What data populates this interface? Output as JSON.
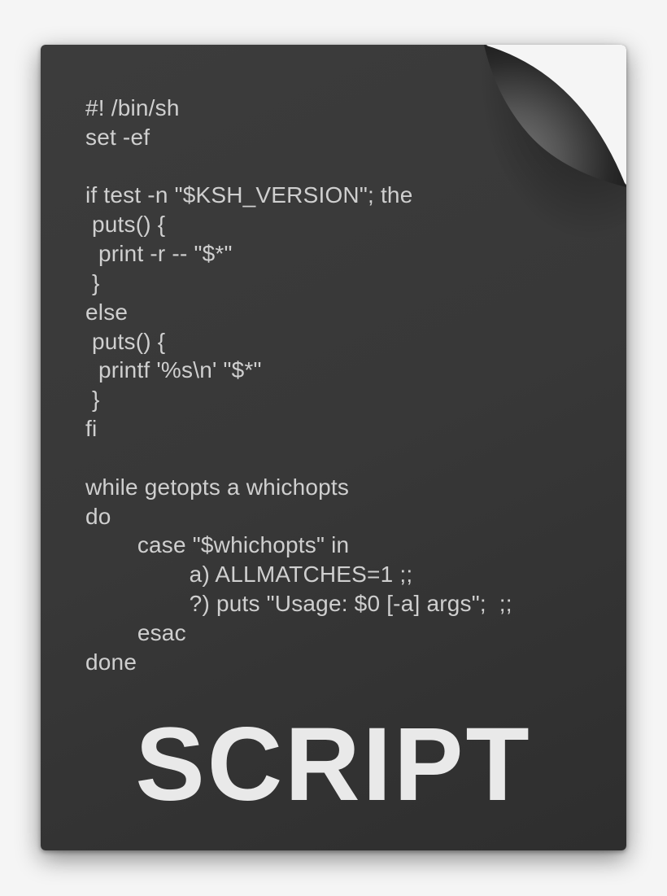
{
  "document": {
    "title_label": "SCRIPT",
    "code_lines": [
      "#! /bin/sh",
      "set -ef",
      "",
      "if test -n \"$KSH_VERSION\"; the",
      " puts() {",
      "  print -r -- \"$*\"",
      " }",
      "else",
      " puts() {",
      "  printf '%s\\n' \"$*\"",
      " }",
      "fi",
      "",
      "while getopts a whichopts",
      "do",
      "        case \"$whichopts\" in",
      "                a) ALLMATCHES=1 ;;",
      "                ?) puts \"Usage: $0 [-a] args\";  ;;",
      "        esac",
      "done"
    ]
  }
}
